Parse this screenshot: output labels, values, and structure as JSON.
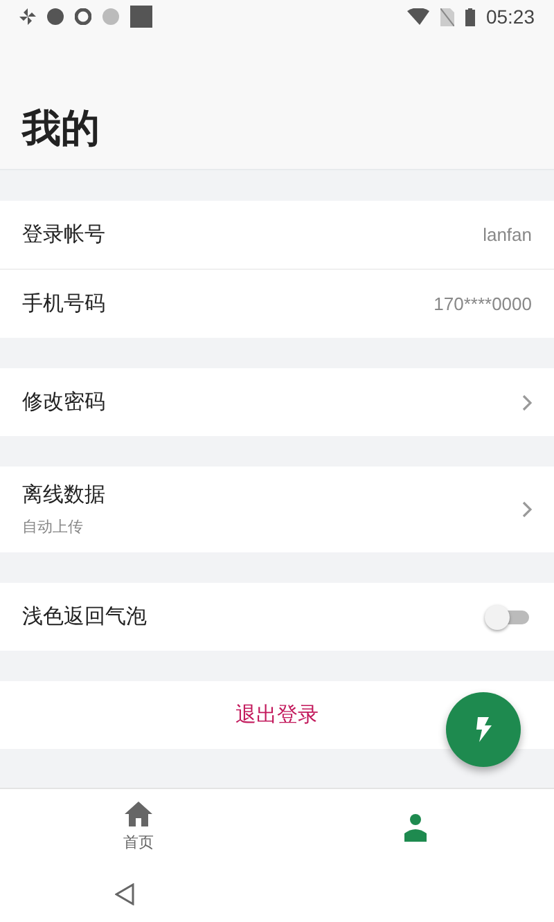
{
  "status_bar": {
    "time": "05:23"
  },
  "title": "我的",
  "sections": [
    {
      "rows": [
        {
          "kind": "value",
          "label": "登录帐号",
          "value": "lanfan"
        },
        {
          "kind": "value",
          "label": "手机号码",
          "value": "170****0000"
        }
      ]
    },
    {
      "rows": [
        {
          "kind": "link",
          "label": "修改密码"
        }
      ]
    },
    {
      "rows": [
        {
          "kind": "link",
          "label": "离线数据",
          "subtitle": "自动上传"
        }
      ]
    },
    {
      "rows": [
        {
          "kind": "toggle",
          "label": "浅色返回气泡",
          "on": false
        }
      ]
    }
  ],
  "logout": {
    "label": "退出登录"
  },
  "tabs": [
    {
      "kind": "home",
      "label": "首页",
      "selected": false
    },
    {
      "kind": "person",
      "selected": true
    }
  ]
}
